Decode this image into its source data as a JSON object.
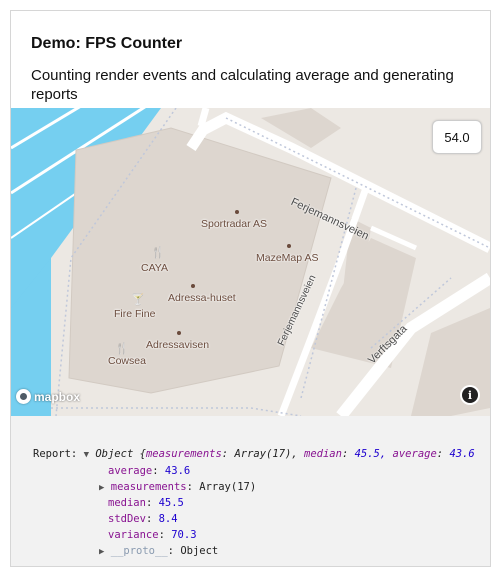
{
  "header": {
    "title": "Demo: FPS Counter",
    "description": "Counting render events and calculating average and generating reports"
  },
  "fps_display": "54.0",
  "map": {
    "roads": [
      "Ferjemannsveien",
      "Ferjemannsveien",
      "Verftsgata"
    ],
    "pois": [
      "Sportradar AS",
      "MazeMap AS",
      "CAYA",
      "Adressa-huset",
      "Fire Fine",
      "Adressavisen",
      "Cowsea"
    ],
    "logo_text": "mapbox",
    "info_icon": "i",
    "colors": {
      "water": "#75cff0",
      "land": "#ece8e3",
      "building": "#ddd6cf",
      "road": "#ffffff"
    }
  },
  "console": {
    "label": "Report:",
    "summary_type": "Object",
    "summary_open": "{",
    "summary_key_1": "measurements",
    "summary_val_1": "Array(17),",
    "summary_key_2": "median",
    "summary_val_2": "45.5,",
    "summary_key_3": "average",
    "summary_val_3": "43.6",
    "props": [
      {
        "key": "average",
        "value": "43.6"
      },
      {
        "key": "measurements",
        "value": "Array(17)"
      },
      {
        "key": "median",
        "value": "45.5"
      },
      {
        "key": "stdDev",
        "value": "8.4"
      },
      {
        "key": "variance",
        "value": "70.3"
      },
      {
        "key": "__proto__",
        "value": "Object"
      }
    ]
  }
}
